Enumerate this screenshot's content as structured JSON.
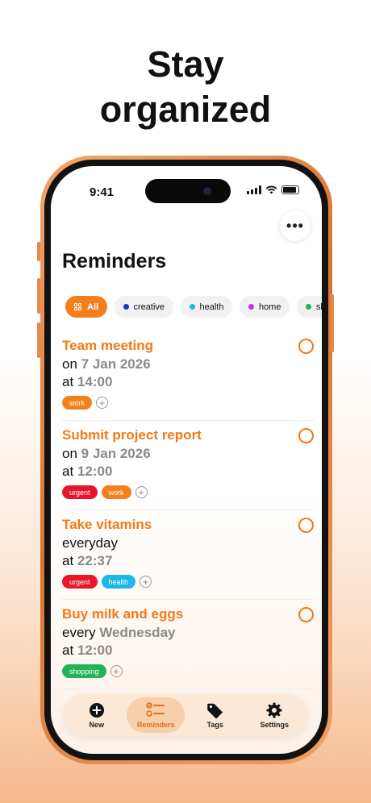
{
  "headline": {
    "line1": "Stay",
    "line2": "organized"
  },
  "status_bar": {
    "time": "9:41"
  },
  "screen": {
    "more_label": "•••",
    "title": "Reminders"
  },
  "filters": [
    {
      "label": "All",
      "active": true,
      "color": "#f47f1d"
    },
    {
      "label": "creative",
      "color": "#1c2fd0"
    },
    {
      "label": "health",
      "color": "#1fb6e8"
    },
    {
      "label": "home",
      "color": "#c82fe0"
    },
    {
      "label": "sh",
      "color": "#22b35a"
    }
  ],
  "reminders": [
    {
      "title": "Team meeting",
      "line1_prefix": "on",
      "line1_value": "7 Jan 2026",
      "line2_prefix": "at",
      "line2_value": "14:00",
      "tags": [
        {
          "label": "work",
          "color": "#f47f1d"
        }
      ]
    },
    {
      "title": "Submit project report",
      "line1_prefix": "on",
      "line1_value": "9 Jan 2026",
      "line2_prefix": "at",
      "line2_value": "12:00",
      "tags": [
        {
          "label": "urgent",
          "color": "#e8162b"
        },
        {
          "label": "work",
          "color": "#f47f1d"
        }
      ]
    },
    {
      "title": "Take vitamins",
      "line1_prefix": "everyday",
      "line1_value": "",
      "line2_prefix": "at",
      "line2_value": "22:37",
      "tags": [
        {
          "label": "urgent",
          "color": "#e8162b"
        },
        {
          "label": "health",
          "color": "#1fb6e8"
        }
      ]
    },
    {
      "title": "Buy milk and eggs",
      "line1_prefix": "every",
      "line1_value": "Wednesday",
      "line2_prefix": "at",
      "line2_value": "12:00",
      "tags": [
        {
          "label": "shopping",
          "color": "#22b35a"
        }
      ]
    }
  ],
  "tabbar": {
    "new": "New",
    "reminders": "Reminders",
    "tags": "Tags",
    "settings": "Settings"
  },
  "add_tag_symbol": "+"
}
